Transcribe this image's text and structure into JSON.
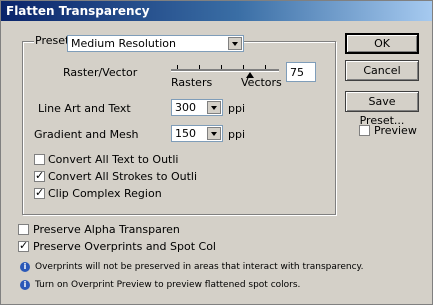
{
  "window": {
    "title": "Flatten Transparency"
  },
  "preset": {
    "label": "Preset:",
    "value": "Medium Resolution"
  },
  "raster_vector": {
    "label": "Raster/Vector",
    "left_label": "Rasters",
    "right_label": "Vectors",
    "value": "75",
    "level_percent": 75
  },
  "line_art": {
    "label": "Line Art and Text",
    "value": "300",
    "unit": "ppi"
  },
  "gradient_mesh": {
    "label": "Gradient and Mesh",
    "value": "150",
    "unit": "ppi"
  },
  "options": [
    {
      "label": "Convert All Text to Outli",
      "checked": false
    },
    {
      "label": "Convert All Strokes to Outli",
      "checked": true
    },
    {
      "label": "Clip Complex Region",
      "checked": true
    }
  ],
  "bottom_options": [
    {
      "label": "Preserve Alpha Transparen",
      "checked": false
    },
    {
      "label": "Preserve Overprints and Spot Col",
      "checked": true
    }
  ],
  "notes": [
    "Overprints will not be preserved in areas that interact with transparency.",
    "Turn on Overprint Preview to preview flattened spot colors."
  ],
  "buttons": {
    "ok": "OK",
    "cancel": "Cancel",
    "save_preset": "Save Preset..."
  },
  "preview": {
    "label": "Preview",
    "checked": false
  }
}
